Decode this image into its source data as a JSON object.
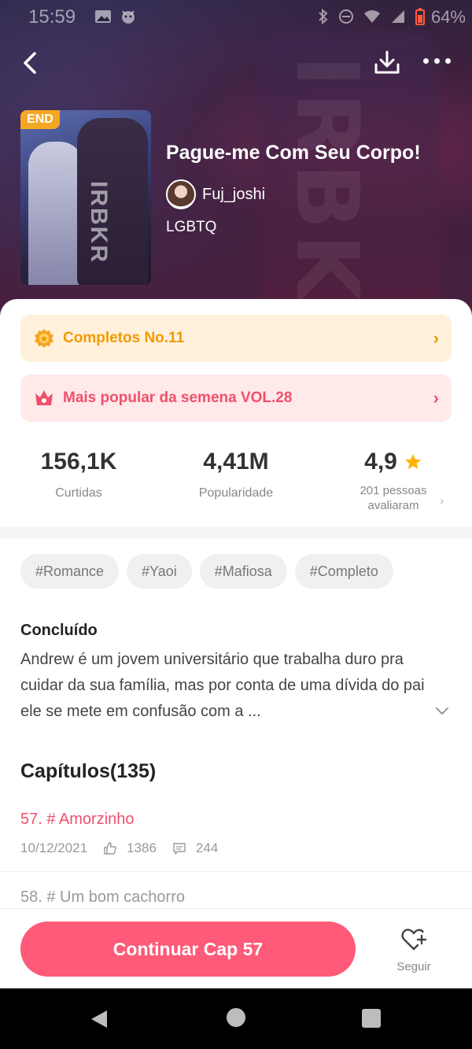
{
  "status_bar": {
    "time": "15:59",
    "battery_percent": "64%",
    "icons": [
      "gallery-icon",
      "devil-emoji-icon",
      "bluetooth-icon",
      "dnd-icon",
      "wifi-icon",
      "signal-icon",
      "battery-icon"
    ]
  },
  "nav": {
    "icons": [
      "back-arrow-icon",
      "download-icon",
      "more-icon"
    ]
  },
  "comic": {
    "badge": "END",
    "title": "Pague-me Com Seu Corpo!",
    "author": "Fuj_joshi",
    "genre": "LGBTQ",
    "cover_text": "IRBKR"
  },
  "banners": [
    {
      "label": "Completos No.11",
      "icon": "medal-icon",
      "color": "#f29a00"
    },
    {
      "label": "Mais popular da semena VOL.28",
      "icon": "crown-icon",
      "color": "#f0506b"
    }
  ],
  "stats": {
    "likes": {
      "value": "156,1K",
      "label": "Curtidas"
    },
    "popularity": {
      "value": "4,41M",
      "label": "Popularidade"
    },
    "rating": {
      "value": "4,9",
      "label_line1": "201 pessoas",
      "label_line2": "avaliaram"
    }
  },
  "tags": [
    "#Romance",
    "#Yaoi",
    "#Mafiosa",
    "#Completo"
  ],
  "description": {
    "status": "Concluído",
    "text": "Andrew é um jovem universitário que trabalha duro pra cuidar da sua família, mas por conta de uma dívida do pai ele se mete em confusão com a ..."
  },
  "chapters": {
    "title": "Capítulos(135)",
    "items": [
      {
        "name": "57. # Amorzinho",
        "date": "10/12/2021",
        "likes": "1386",
        "comments": "244"
      },
      {
        "name": "58. # Um bom cachorro"
      }
    ]
  },
  "actions": {
    "continue_label": "Continuar Cap 57",
    "follow_label": "Seguir"
  },
  "colors": {
    "accent": "#ff5a78",
    "gold": "#f29a00",
    "star": "#ffb400"
  }
}
